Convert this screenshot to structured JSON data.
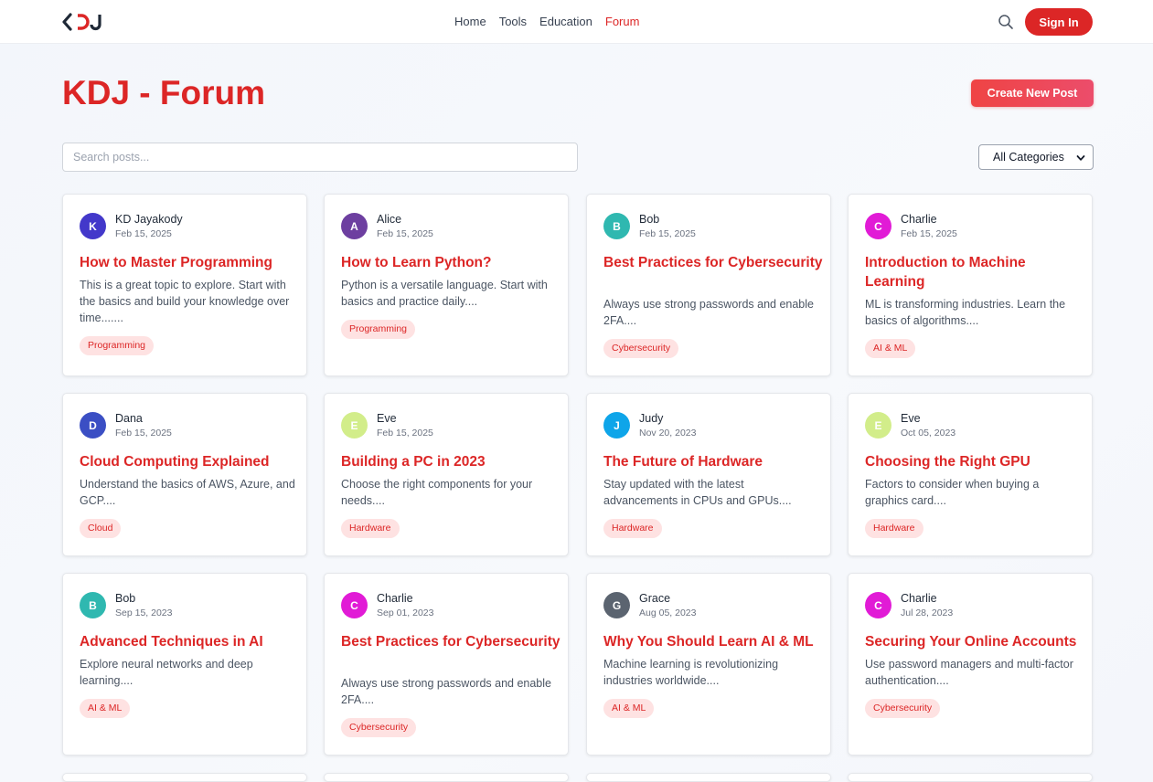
{
  "brand": {
    "logo_text": "KDJ"
  },
  "nav": {
    "home": "Home",
    "tools": "Tools",
    "education": "Education",
    "forum": "Forum",
    "sign_in": "Sign In"
  },
  "page": {
    "title": "KDJ - Forum",
    "create_label": "Create New Post"
  },
  "search": {
    "placeholder": "Search posts..."
  },
  "category_filter": {
    "selected": "All Categories"
  },
  "colors": {
    "accent": "#dc2626",
    "tag_bg": "#fee2e2"
  },
  "posts": [
    {
      "initial": "K",
      "author": "KD Jayakody",
      "date": "Feb 15, 2025",
      "title": "How to Master Programming",
      "excerpt": "This is a great topic to explore. Start with the basics and build your knowledge over time.......",
      "tag": "Programming",
      "avatar_color": "#4338ca"
    },
    {
      "initial": "A",
      "author": "Alice",
      "date": "Feb 15, 2025",
      "title": "How to Learn Python?",
      "excerpt": "Python is a versatile language. Start with basics and practice daily....",
      "tag": "Programming",
      "avatar_color": "#6d3fa0"
    },
    {
      "initial": "B",
      "author": "Bob",
      "date": "Feb 15, 2025",
      "title": "Best Practices for Cybersecurity",
      "excerpt": "Always use strong passwords and enable 2FA....",
      "tag": "Cybersecurity",
      "avatar_color": "#2fb8b0"
    },
    {
      "initial": "C",
      "author": "Charlie",
      "date": "Feb 15, 2025",
      "title": "Introduction to Machine Learning",
      "excerpt": "ML is transforming industries. Learn the basics of algorithms....",
      "tag": "AI & ML",
      "avatar_color": "#e11bd6"
    },
    {
      "initial": "D",
      "author": "Dana",
      "date": "Feb 15, 2025",
      "title": "Cloud Computing Explained",
      "excerpt": "Understand the basics of AWS, Azure, and GCP....",
      "tag": "Cloud",
      "avatar_color": "#3b4fc4"
    },
    {
      "initial": "E",
      "author": "Eve",
      "date": "Feb 15, 2025",
      "title": "Building a PC in 2023",
      "excerpt": "Choose the right components for your needs....",
      "tag": "Hardware",
      "avatar_color": "#d2ed8a"
    },
    {
      "initial": "J",
      "author": "Judy",
      "date": "Nov 20, 2023",
      "title": "The Future of Hardware",
      "excerpt": "Stay updated with the latest advancements in CPUs and GPUs....",
      "tag": "Hardware",
      "avatar_color": "#0ea5e9"
    },
    {
      "initial": "E",
      "author": "Eve",
      "date": "Oct 05, 2023",
      "title": "Choosing the Right GPU",
      "excerpt": "Factors to consider when buying a graphics card....",
      "tag": "Hardware",
      "avatar_color": "#d2ed8a"
    },
    {
      "initial": "B",
      "author": "Bob",
      "date": "Sep 15, 2023",
      "title": "Advanced Techniques in AI",
      "excerpt": "Explore neural networks and deep learning....",
      "tag": "AI & ML",
      "avatar_color": "#2fb8b0"
    },
    {
      "initial": "C",
      "author": "Charlie",
      "date": "Sep 01, 2023",
      "title": "Best Practices for Cybersecurity",
      "excerpt": "Always use strong passwords and enable 2FA....",
      "tag": "Cybersecurity",
      "avatar_color": "#e11bd6"
    },
    {
      "initial": "G",
      "author": "Grace",
      "date": "Aug 05, 2023",
      "title": "Why You Should Learn AI & ML",
      "excerpt": "Machine learning is revolutionizing industries worldwide....",
      "tag": "AI & ML",
      "avatar_color": "#5b6470"
    },
    {
      "initial": "C",
      "author": "Charlie",
      "date": "Jul 28, 2023",
      "title": "Securing Your Online Accounts",
      "excerpt": "Use password managers and multi-factor authentication....",
      "tag": "Cybersecurity",
      "avatar_color": "#e11bd6"
    }
  ]
}
